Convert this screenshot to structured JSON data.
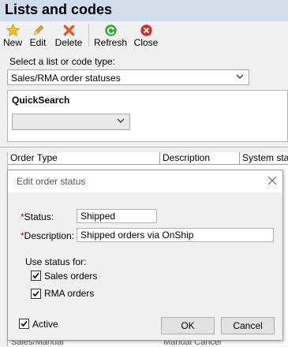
{
  "window": {
    "title": "Lists and codes"
  },
  "toolbar": {
    "new": {
      "label": "New",
      "icon": "star-icon"
    },
    "edit": {
      "label": "Edit",
      "icon": "pencil-icon"
    },
    "delete": {
      "label": "Delete",
      "icon": "x-icon"
    },
    "refresh": {
      "label": "Refresh",
      "icon": "refresh-icon"
    },
    "close": {
      "label": "Close",
      "icon": "close-circle-icon"
    }
  },
  "list_selector": {
    "label": "Select a list or code type:",
    "value": "Sales/RMA order statuses"
  },
  "quicksearch": {
    "label": "QuickSearch",
    "value": ""
  },
  "grid": {
    "columns": [
      "Order Type",
      "Description",
      "System status"
    ],
    "row_fragments": [
      "Sales/Manual",
      "Manual Cancel"
    ]
  },
  "dialog": {
    "title": "Edit order status",
    "status_label": "Status:",
    "status_value": "Shipped",
    "description_label": "Description:",
    "description_value": "Shipped orders via OnShip",
    "use_for_label": "Use status for:",
    "sales_orders_label": "Sales orders",
    "sales_orders_checked": true,
    "rma_orders_label": "RMA orders",
    "rma_orders_checked": true,
    "active_label": "Active",
    "active_checked": true,
    "ok_label": "OK",
    "cancel_label": "Cancel"
  },
  "colors": {
    "titlebar": "#cfdceb",
    "required": "#c00000"
  }
}
